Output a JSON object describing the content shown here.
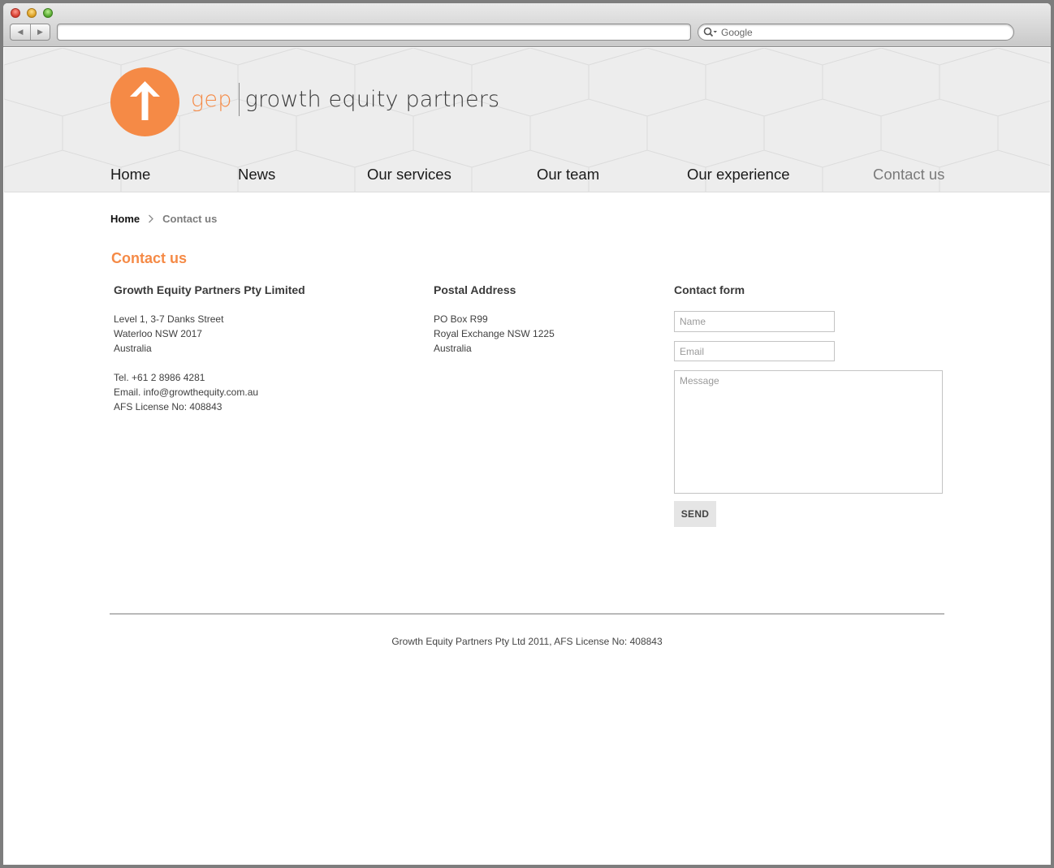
{
  "browser": {
    "search_placeholder": "Google",
    "back_label": "◀",
    "forward_label": "▶"
  },
  "site": {
    "logo_abbr": "gep",
    "logo_name": "growth equity partners",
    "brand_color": "#f58a46"
  },
  "nav": {
    "items": [
      {
        "label": "Home"
      },
      {
        "label": "News"
      },
      {
        "label": "Our services"
      },
      {
        "label": "Our team"
      },
      {
        "label": "Our experience"
      },
      {
        "label": "Contact us",
        "active": true
      }
    ]
  },
  "breadcrumb": {
    "home": "Home",
    "current": "Contact us"
  },
  "page": {
    "title": "Contact us"
  },
  "company": {
    "heading": "Growth Equity Partners Pty Limited",
    "address": [
      "Level 1, 3-7 Danks Street",
      "Waterloo NSW 2017",
      "Australia"
    ],
    "phone": "Tel. +61 2 8986 4281",
    "email": "Email. info@growthequity.com.au",
    "license": "AFS License No: 408843"
  },
  "postal": {
    "heading": "Postal Address",
    "lines": [
      "PO Box R99",
      "Royal Exchange NSW 1225",
      "Australia"
    ]
  },
  "contact_form": {
    "heading": "Contact form",
    "name_placeholder": "Name",
    "email_placeholder": "Email",
    "message_placeholder": "Message",
    "send_label": "SEND"
  },
  "footer": {
    "text": "Growth Equity Partners Pty Ltd 2011, AFS License No: 408843"
  }
}
